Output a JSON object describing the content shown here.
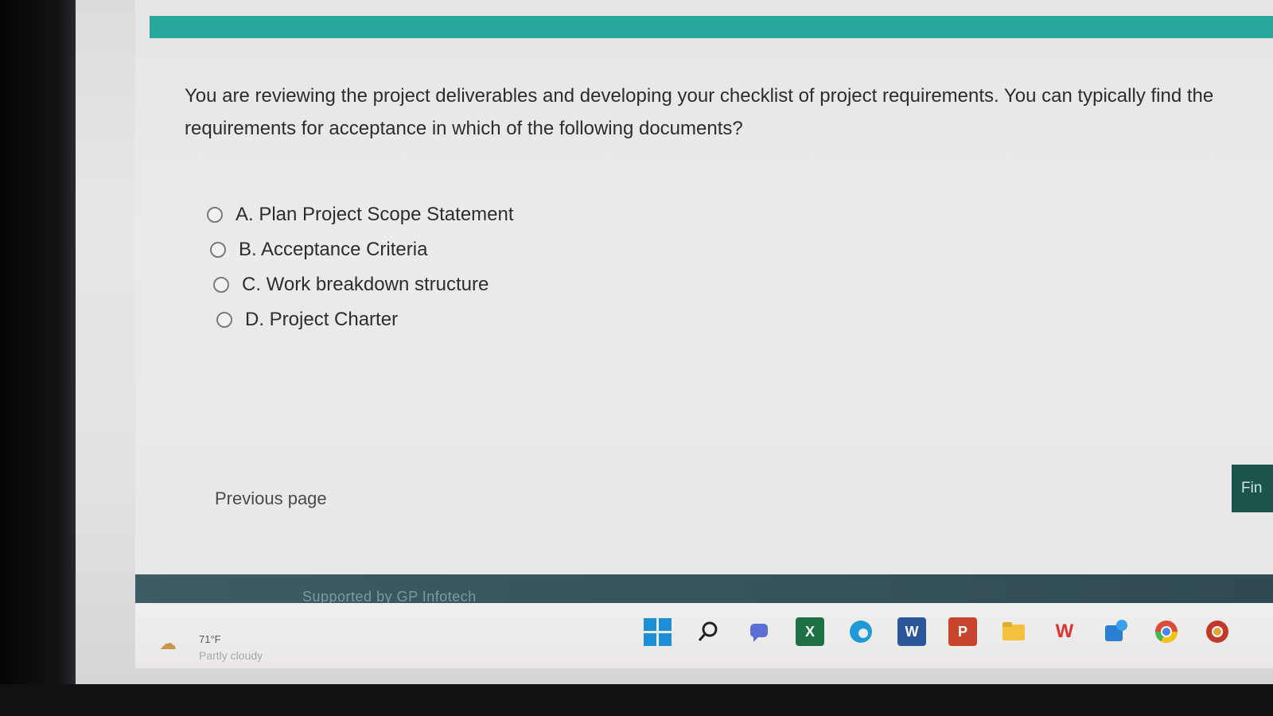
{
  "question": {
    "text": "You are reviewing the project deliverables and developing your checklist of project requirements. You can typically find the requirements for acceptance in which of the following documents?"
  },
  "options": [
    {
      "label": "A. Plan Project Scope Statement",
      "selected": false
    },
    {
      "label": "B. Acceptance Criteria",
      "selected": false
    },
    {
      "label": "C. Work breakdown structure",
      "selected": false
    },
    {
      "label": "D. Project Charter",
      "selected": false
    }
  ],
  "navigation": {
    "previous_label": "Previous page",
    "finish_label": "Fin"
  },
  "footer": {
    "supported_by": "Supported by GP Infotech"
  },
  "taskbar": {
    "weather_temp": "71°F",
    "weather_desc": "Partly cloudy",
    "icons": [
      "windows-start-icon",
      "search-icon",
      "chat-icon",
      "excel-icon",
      "edge-icon",
      "word-icon",
      "powerpoint-icon",
      "file-explorer-icon",
      "wps-icon",
      "app-icon",
      "chrome-icon",
      "chrome-canary-icon"
    ]
  },
  "colors": {
    "accent_bar": "#29a89b",
    "finish_button": "#1a544a",
    "footer_bar": "#36525a"
  }
}
